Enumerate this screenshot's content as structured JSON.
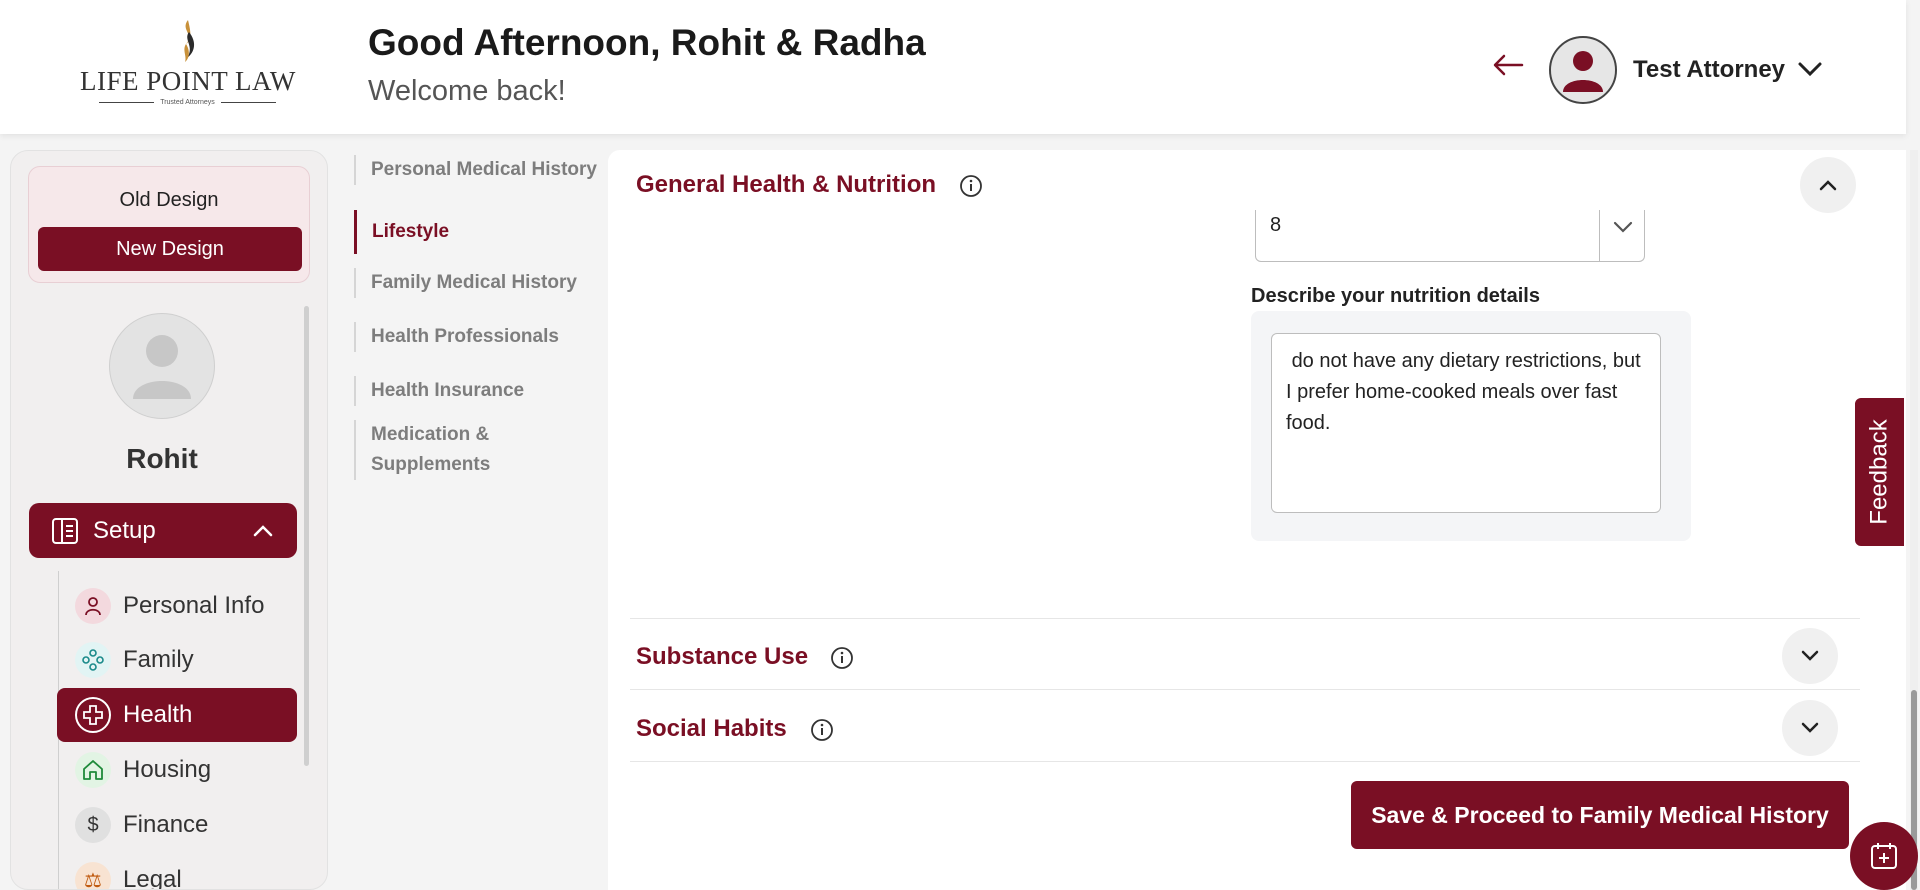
{
  "header": {
    "logo_text": "LIFE POINT LAW",
    "logo_tagline": "Trusted Attorneys",
    "greeting": "Good Afternoon, Rohit & Radha",
    "welcome": "Welcome back!",
    "user_name": "Test Attorney"
  },
  "sidebar": {
    "old_design": "Old Design",
    "new_design": "New Design",
    "profile_name": "Rohit",
    "setup_label": "Setup",
    "items": [
      {
        "label": "Personal Info",
        "icon": "person-icon"
      },
      {
        "label": "Family",
        "icon": "family-icon"
      },
      {
        "label": "Health",
        "icon": "health-plus-icon",
        "active": true
      },
      {
        "label": "Housing",
        "icon": "house-icon"
      },
      {
        "label": "Finance",
        "icon": "dollar-icon"
      },
      {
        "label": "Legal",
        "icon": "legal-icon"
      }
    ]
  },
  "subnav": {
    "items": [
      {
        "label": "Personal Medical History"
      },
      {
        "label": "Lifestyle",
        "active": true
      },
      {
        "label": "Family Medical History"
      },
      {
        "label": "Health Professionals"
      },
      {
        "label": "Health Insurance"
      },
      {
        "label": "Medication & Supplements"
      }
    ]
  },
  "main": {
    "sections": [
      {
        "title": "General Health & Nutrition",
        "expanded": true
      },
      {
        "title": "Substance Use",
        "expanded": false
      },
      {
        "title": "Social Habits",
        "expanded": false
      }
    ],
    "select_value": "8",
    "nutrition_label": "Describe your nutrition details",
    "nutrition_text": " do not have any dietary restrictions, but I prefer home-cooked meals over fast food.",
    "save_button": "Save & Proceed to Family Medical History"
  },
  "feedback_label": "Feedback",
  "colors": {
    "brand": "#7a0f24",
    "muted_text": "#7d7d7d",
    "panel_bg": "#f4f5f7"
  }
}
